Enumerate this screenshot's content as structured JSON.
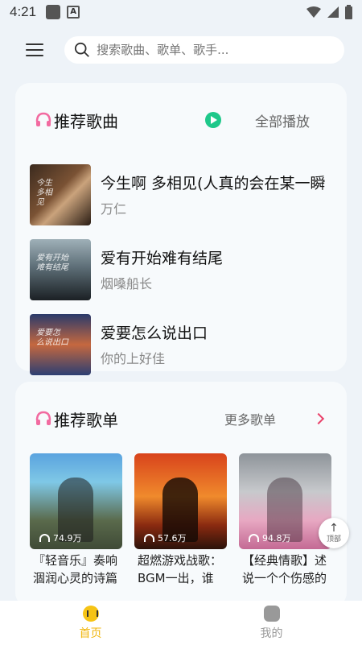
{
  "status": {
    "time": "4:21"
  },
  "search": {
    "placeholder": "搜索歌曲、歌单、歌手..."
  },
  "songs_section": {
    "title": "推荐歌曲",
    "play_all": "全部播放",
    "items": [
      {
        "title": "今生啊 多相见(人真的会在某一瞬",
        "artist": "万仁"
      },
      {
        "title": "爱有开始难有结尾",
        "artist": "烟嗓船长"
      },
      {
        "title": "爱要怎么说出口",
        "artist": "你的上好佳"
      }
    ]
  },
  "playlists_section": {
    "title": "推荐歌单",
    "more": "更多歌单",
    "items": [
      {
        "name": "『轻音乐』奏响涸润心灵的诗篇",
        "plays": "74.9万"
      },
      {
        "name": "超燃游戏战歌：BGM一出，谁与争锋",
        "plays": "57.6万"
      },
      {
        "name": "【经典情歌】述说一个个伤感的故事",
        "plays": "94.8万"
      }
    ]
  },
  "back_to_top": "顶部",
  "nav": {
    "home": "首页",
    "mine": "我的"
  },
  "colors": {
    "accent": "#f0b60c",
    "play": "#1ec88a",
    "chevron": "#e9416a"
  }
}
